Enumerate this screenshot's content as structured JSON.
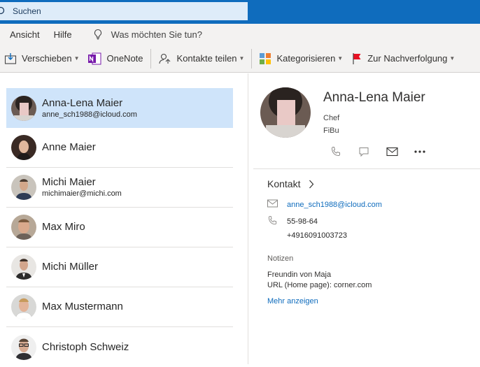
{
  "colors": {
    "brand": "#0f6cbd",
    "search_bg": "#deecf9",
    "selected_row": "#cfe4fa",
    "ribbon_bg": "#f3f2f1"
  },
  "search": {
    "value": "Suchen"
  },
  "menu": {
    "ansicht": "Ansicht",
    "hilfe": "Hilfe",
    "tell_me": "Was möchten Sie tun?"
  },
  "toolbar": {
    "verschieben": "Verschieben",
    "onenote": "OneNote",
    "kontakte_teilen": "Kontakte teilen",
    "kategorisieren": "Kategorisieren",
    "nachverfolgung": "Zur Nachverfolgung"
  },
  "contacts": [
    {
      "name": "Anna-Lena Maier",
      "email": "anne_sch1988@icloud.com",
      "selected": true
    },
    {
      "name": "Anne Maier",
      "email": ""
    },
    {
      "name": "Michi Maier",
      "email": "michimaier@michi.com"
    },
    {
      "name": "Max Miro",
      "email": ""
    },
    {
      "name": "Michi Müller",
      "email": ""
    },
    {
      "name": "Max Mustermann",
      "email": ""
    },
    {
      "name": "Christoph Schweiz",
      "email": ""
    }
  ],
  "detail": {
    "name": "Anna-Lena Maier",
    "job_title": "Chef",
    "department": "FiBu",
    "section_label": "Kontakt",
    "email": "anne_sch1988@icloud.com",
    "phone1": "55-98-64",
    "phone2": "+4916091003723",
    "notes_label": "Notizen",
    "note_line1": "Freundin von Maja",
    "note_line2": "URL (Home page): corner.com",
    "more_label": "Mehr anzeigen"
  }
}
